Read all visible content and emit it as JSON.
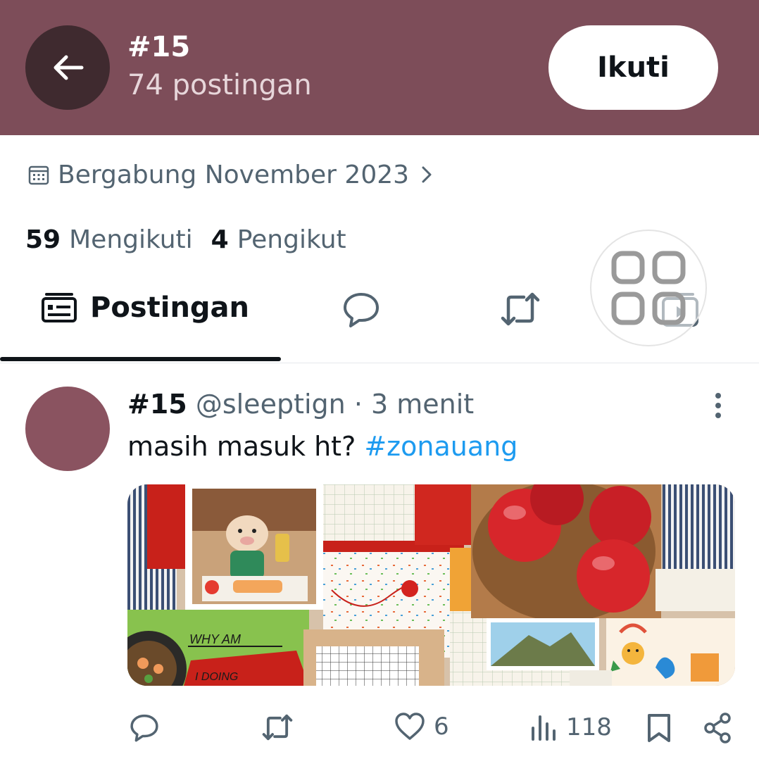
{
  "header": {
    "title": "#15",
    "post_count": "74 postingan",
    "follow_label": "Ikuti",
    "background_color": "#7d4d59"
  },
  "profile": {
    "joined": "Bergabung November 2023",
    "following_count": "59",
    "following_label": "Mengikuti",
    "followers_count": "4",
    "followers_label": "Pengikut"
  },
  "tabs": {
    "active_label": "Postingan",
    "icons": [
      "posts-icon",
      "reply-icon",
      "repost-icon",
      "media-icon"
    ]
  },
  "post": {
    "display_name": "#15",
    "handle": "@sleeptign",
    "separator": "·",
    "time": "3 menit",
    "text": "masih masuk ht? ",
    "hashtag": "#zonauang",
    "image_label_text": "WHY AM I DOING",
    "actions": {
      "likes": "6",
      "views": "118"
    }
  }
}
